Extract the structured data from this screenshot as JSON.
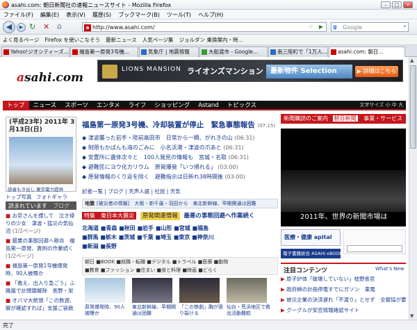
{
  "window": {
    "title": "asahi.com: 朝日新聞社の速報ニュースサイト - Mozilla Firefox"
  },
  "menu": [
    "ファイル(F)",
    "編集(E)",
    "表示(V)",
    "履歴(S)",
    "ブックマーク(B)",
    "ツール(T)",
    "ヘルプ(H)"
  ],
  "url": "http://www.asahi.com/",
  "search_placeholder": "Google",
  "bookmarks": [
    "よく見るページ",
    "Firefox を使いこなそう",
    "最新ニュース",
    "人気ページ集",
    "ジョルダン 乗換案内・時..."
  ],
  "tabs": [
    "Yahoo!ジオシティーズ...",
    "福島第一原発3号機...",
    "気象庁 | 地震情報",
    "大船渡市 - Google...",
    "南三陸町で「1万人...",
    "asahi.com: 朝日..."
  ],
  "status": "完了",
  "site": {
    "logo": "asahi.com",
    "banner": {
      "brand": "LIONS MANSION",
      "brand_jp": "ライオンズマンション",
      "selection": "最新物件 Selection",
      "detail": "▶ 詳細はこちら"
    },
    "nav": [
      "トップ",
      "ニュース",
      "スポーツ",
      "エンタメ",
      "ライフ",
      "ショッピング",
      "Astand",
      "トピックス"
    ],
    "font_size": "文字サイズ 小 中 大",
    "date_label": "(平成23年) 2011年 3月13日(日)",
    "date_caption": "読者もき出し 東京電力提供",
    "side_links": [
      "トップ写真",
      "フォトギャラ"
    ],
    "read_tab": "読まれています",
    "blog_tab": "ブログ",
    "ranking": [
      "お奈さんを捜して　泣き帰りの少女　津波・猛災の気仙沼",
      "最悪の事態回避へ懸命　福島第一原発、異例の作業続く",
      "福島第一原発1号機爆発時、90人被曝か",
      "「救え、出入り急ごう」ふ路援で計閉鎖解除　長野・栄",
      "オバマ大統領「この数週、解が確認すれば」支援ご容赦"
    ],
    "ranking_dates": [
      "(1/2ページ)",
      "(1/2ページ)"
    ],
    "headline": "福島第一原発3号機、冷却装置が停止　緊急事態報告",
    "headline_time": "(07:15)",
    "news": [
      {
        "text": "津波襲った岩手・陸前高田市　日常から一瞬、がれきの山",
        "time": "(06:31)"
      },
      {
        "text": "制限もかばんも海のごみに　小名浜港・津波の爪あと",
        "time": "(06:31)"
      },
      {
        "text": "安置所に遺体次々と　100人発見の情報も　宮城・名取",
        "time": "(06:31)"
      },
      {
        "text": "避難民にヨウ化カリウム　原発爆発「いつ帰れる」",
        "time": "(03:00)"
      },
      {
        "text": "原発情報のくり返を除く　避難指示は日新れ38時間後",
        "time": "(03:00)"
      }
    ],
    "sub_links": [
      "記者一覧",
      "ブログ",
      "天声人語",
      "社説",
      "天気"
    ],
    "region_label": "地震",
    "quake_info": "[被災者の情報]　大阪・新千歳・羽田から　東北新幹線、早期開通は困難",
    "quake_banner": "特集　東日本大震災",
    "quake_banner2": "原発関連情報",
    "quake_banner3": "最悪の事態回避へ作業続く",
    "regions": [
      "北海道",
      "青森",
      "秋田",
      "岩手",
      "山形",
      "宮城",
      "福島",
      "群馬",
      "栃木",
      "茨城",
      "千葉",
      "埼玉",
      "東京",
      "神奈川",
      "新潟",
      "長野"
    ],
    "categories": [
      "朝日",
      "BOOK",
      "就職・転職",
      "デジタル",
      "トラベル",
      "医療",
      "動物",
      "教育",
      "ファッション",
      "住まい",
      "食と料理",
      "映画",
      "どらく"
    ],
    "thumb_captions": [
      "原発爆発時、90人被曝か",
      "東北新幹線、早期開通は困難",
      "「この惨劇」胸が張り裂ける",
      "仙台・荒浜地区で救出活動難航"
    ],
    "right_header": "新聞購読のご案内",
    "right_header2": "朝日新聞",
    "right_header3": "事業・サービス紹介",
    "video_caption": "2011年、世界の新聞市場は",
    "medical": "医療・健康 apital",
    "ebook": "電子書籍総合 ASAHI eBOOK AVENUE",
    "attention": "注目コンテンツ",
    "whats_new": "What's New",
    "right_news": [
      "原子炉体「破壊していない」枝野長官",
      "政府締の計画停電すでにガソン　東電",
      "被災企業の決済遅れ「不渡り」とせず　全銀協が要請",
      "グーグルが安否情報確認サイト"
    ]
  }
}
